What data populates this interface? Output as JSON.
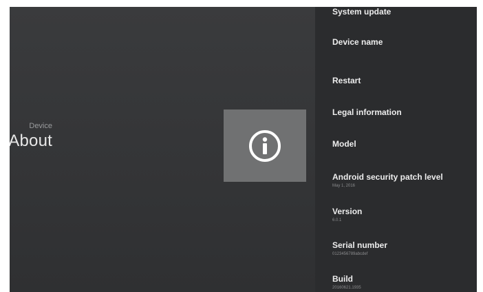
{
  "header": {
    "category": "Device",
    "title": "About"
  },
  "icon": {
    "name": "info-icon",
    "tile_color": "#707172",
    "glyph_color": "#ffffff"
  },
  "menu": {
    "items": [
      {
        "id": "system-update",
        "title": "System update",
        "subtitle": ""
      },
      {
        "id": "device-name",
        "title": "Device name",
        "subtitle": ""
      },
      {
        "id": "restart",
        "title": "Restart",
        "subtitle": ""
      },
      {
        "id": "legal-information",
        "title": "Legal information",
        "subtitle": ""
      },
      {
        "id": "model",
        "title": "Model",
        "subtitle": ""
      },
      {
        "id": "security-patch",
        "title": "Android security patch level",
        "subtitle": "May 1, 2016"
      },
      {
        "id": "version",
        "title": "Version",
        "subtitle": "6.0.1"
      },
      {
        "id": "serial-number",
        "title": "Serial number",
        "subtitle": "0123456789abcdef"
      },
      {
        "id": "build",
        "title": "Build",
        "subtitle": "20160621.1935"
      }
    ]
  }
}
